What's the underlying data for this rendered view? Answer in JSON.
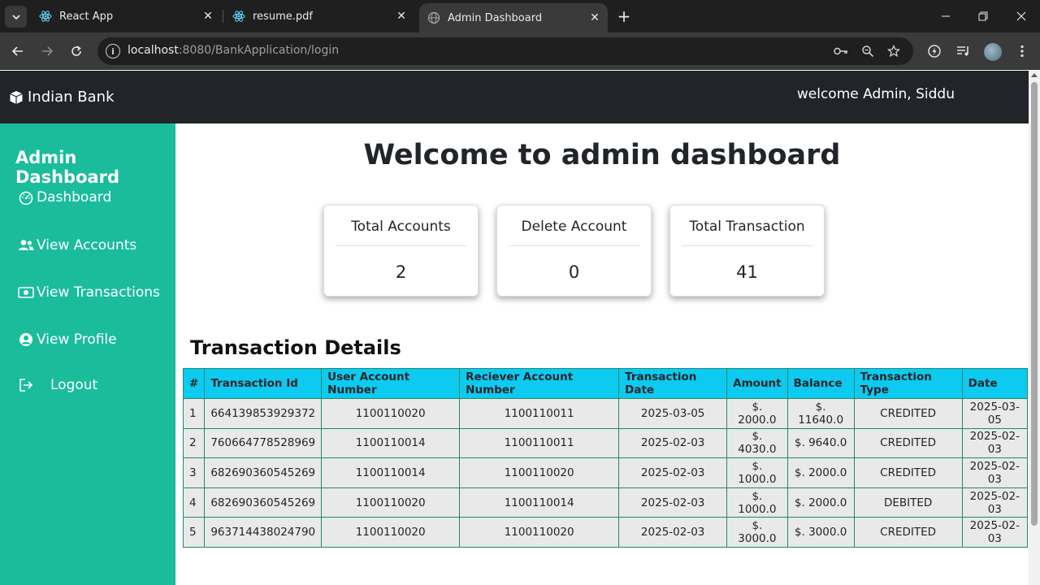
{
  "browser": {
    "tabs": [
      {
        "title": "React App"
      },
      {
        "title": "resume.pdf"
      },
      {
        "title": "Admin Dashboard"
      }
    ],
    "url_host": "localhost",
    "url_path": ":8080/BankApplication/login"
  },
  "navbar": {
    "brand": "Indian Bank",
    "welcome": "welcome Admin, Siddu"
  },
  "sidebar": {
    "title": "Admin Dashboard",
    "items": [
      {
        "label": "Dashboard",
        "icon": "gauge-icon"
      },
      {
        "label": "View Accounts",
        "icon": "users-icon"
      },
      {
        "label": "View Transactions",
        "icon": "money-bill-icon"
      },
      {
        "label": "View Profile",
        "icon": "user-circle-icon"
      },
      {
        "label": "Logout",
        "icon": "logout-icon"
      }
    ]
  },
  "main": {
    "title": "Welcome to admin dashboard",
    "cards": [
      {
        "title": "Total Accounts",
        "value": "2"
      },
      {
        "title": "Delete Account",
        "value": "0"
      },
      {
        "title": "Total Transaction",
        "value": "41"
      }
    ]
  },
  "transactions": {
    "title": "Transaction Details",
    "columns": [
      "#",
      "Transaction Id",
      "User Account Number",
      "Reciever Account Number",
      "Transaction Date",
      "Amount",
      "Balance",
      "Transaction Type",
      "Date"
    ],
    "rows": [
      [
        "1",
        "664139853929372",
        "1100110020",
        "1100110011",
        "2025-03-05",
        "$. 2000.0",
        "$. 11640.0",
        "CREDITED",
        "2025-03-05"
      ],
      [
        "2",
        "760664778528969",
        "1100110014",
        "1100110011",
        "2025-02-03",
        "$. 4030.0",
        "$. 9640.0",
        "CREDITED",
        "2025-02-03"
      ],
      [
        "3",
        "682690360545269",
        "1100110014",
        "1100110020",
        "2025-02-03",
        "$. 1000.0",
        "$. 2000.0",
        "CREDITED",
        "2025-02-03"
      ],
      [
        "4",
        "682690360545269",
        "1100110020",
        "1100110014",
        "2025-02-03",
        "$. 1000.0",
        "$. 2000.0",
        "DEBITED",
        "2025-02-03"
      ],
      [
        "5",
        "963714438024790",
        "1100110020",
        "1100110020",
        "2025-02-03",
        "$. 3000.0",
        "$. 3000.0",
        "CREDITED",
        "2025-02-03"
      ]
    ]
  },
  "colors": {
    "sidebar": "#1abc9c",
    "navbar": "#212529",
    "table_header": "#0dcaf0",
    "table_border": "#1e8a6b"
  }
}
